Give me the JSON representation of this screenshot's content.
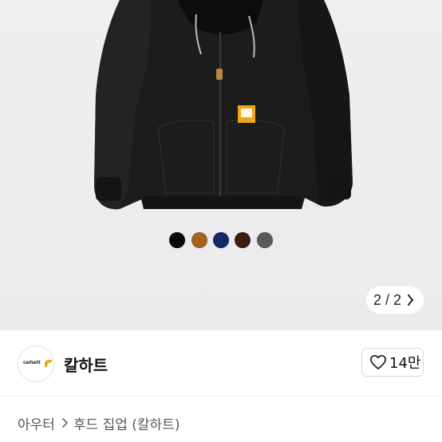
{
  "product": {
    "color_options": [
      {
        "name": "black",
        "color": "#0a0a0a"
      },
      {
        "name": "brown",
        "color": "#a5631f"
      },
      {
        "name": "navy",
        "color": "#15286a"
      },
      {
        "name": "dark-brown",
        "color": "#3e1d10"
      },
      {
        "name": "gray",
        "color": "#5a5a5a"
      }
    ],
    "pager": {
      "text": "2 / 2"
    }
  },
  "brand": {
    "logo_text": "carhartt",
    "name": "칼하트",
    "like_count": "14만"
  },
  "breadcrumb": {
    "category": "아우터",
    "subcategory": "후드 집업 (칼하트)"
  },
  "colors": {
    "background": "#eeeef0",
    "accent_gold": "#f2a51c"
  }
}
